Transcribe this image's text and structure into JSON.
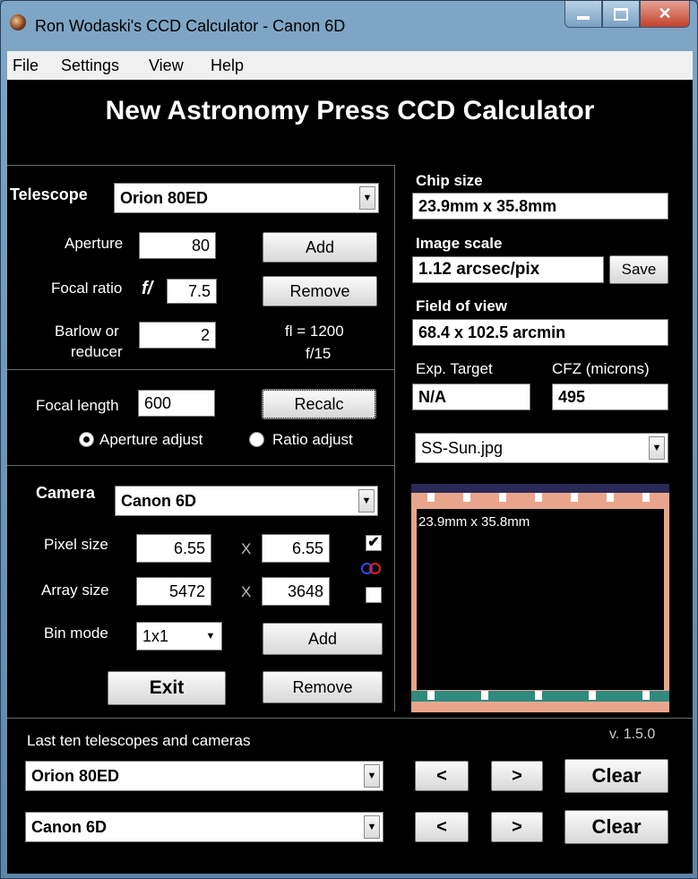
{
  "window": {
    "title": "Ron Wodaski's CCD Calculator - Canon 6D"
  },
  "menu": [
    "File",
    "Settings",
    "View",
    "Help"
  ],
  "header": "New Astronomy Press CCD Calculator",
  "telescope": {
    "label": "Telescope",
    "selected": "Orion 80ED",
    "aperture_label": "Aperture",
    "aperture": "80",
    "focal_ratio_label": "Focal ratio",
    "f_prefix": "f/",
    "focal_ratio": "7.5",
    "barlow_label_1": "Barlow or",
    "barlow_label_2": "reducer",
    "barlow": "2",
    "add_label": "Add",
    "remove_label": "Remove",
    "fl_readout": "fl = 1200",
    "f_readout": "f/15"
  },
  "focal": {
    "label": "Focal length",
    "value": "600",
    "recalc_label": "Recalc",
    "aperture_adjust": "Aperture adjust",
    "ratio_adjust": "Ratio adjust"
  },
  "camera": {
    "label": "Camera",
    "selected": "Canon 6D",
    "pixel_label": "Pixel size",
    "pixel_x": "6.55",
    "pixel_y": "6.55",
    "array_label": "Array size",
    "array_x": "5472",
    "array_y": "3648",
    "times": "X",
    "bin_label": "Bin mode",
    "bin_value": "1x1",
    "add_label": "Add",
    "remove_label": "Remove",
    "exit_label": "Exit"
  },
  "results": {
    "chip_label": "Chip size",
    "chip_value": "23.9mm x 35.8mm",
    "scale_label": "Image scale",
    "scale_value": "1.12 arcsec/pix",
    "save_label": "Save",
    "fov_label": "Field of view",
    "fov_value": "68.4 x 102.5 arcmin",
    "exp_label": "Exp. Target",
    "exp_value": "N/A",
    "cfz_label": "CFZ  (microns)",
    "cfz_value": "495",
    "image_selected": "SS-Sun.jpg",
    "preview_caption": "23.9mm x 35.8mm"
  },
  "history": {
    "label": "Last ten telescopes and cameras",
    "version": "v. 1.5.0",
    "telescope": "Orion 80ED",
    "camera": "Canon 6D",
    "prev": "<",
    "next": ">",
    "clear": "Clear"
  },
  "colors": {
    "background": "#000000",
    "frame": "#6f98bb",
    "preview_border": "#e9a58b"
  }
}
